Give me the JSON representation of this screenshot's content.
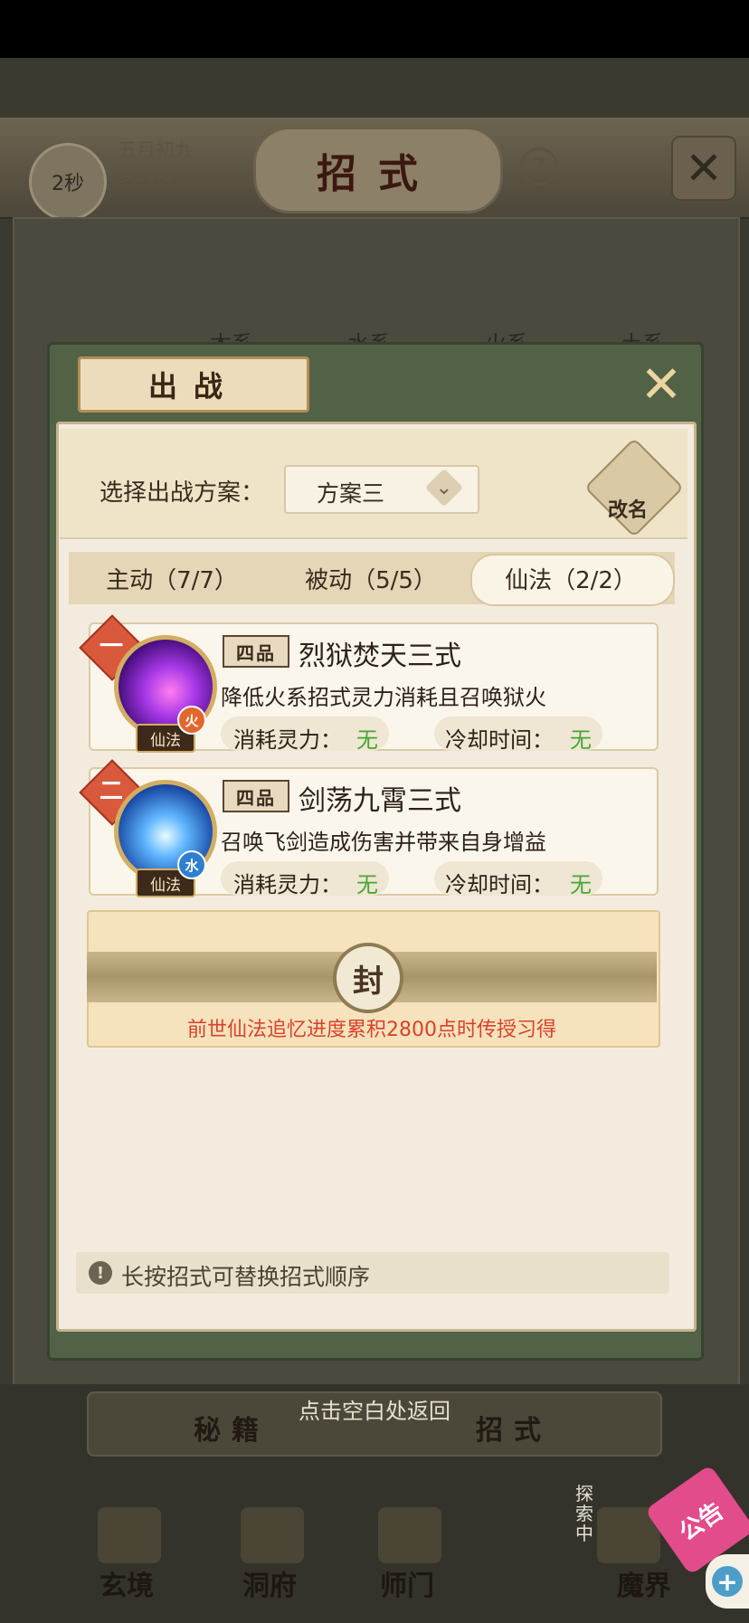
{
  "background": {
    "timer": "2秒",
    "date_line1": "五月初九",
    "date_line2": "亥时夜",
    "title": "招式",
    "help": "?",
    "element_tabs": [
      "木系",
      "水系",
      "火系",
      "土系"
    ]
  },
  "dialog": {
    "title": "出战",
    "scheme_label": "选择出战方案：",
    "scheme_value": "方案三",
    "rename_label": "改名",
    "tabs": [
      {
        "label": "主动（7/7）",
        "active": false
      },
      {
        "label": "被动（5/5）",
        "active": false
      },
      {
        "label": "仙法（2/2）",
        "active": true
      }
    ],
    "skills": [
      {
        "rank": "一",
        "grade": "四品",
        "name": "烈狱焚天三式",
        "description": "降低火系招式灵力消耗且召唤狱火",
        "type_tag": "仙法",
        "element": "火",
        "cost_label": "消耗灵力：",
        "cost_value": "无",
        "cooldown_label": "冷却时间：",
        "cooldown_value": "无"
      },
      {
        "rank": "二",
        "grade": "四品",
        "name": "剑荡九霄三式",
        "description": "召唤飞剑造成伤害并带来自身增益",
        "type_tag": "仙法",
        "element": "水",
        "cost_label": "消耗灵力：",
        "cost_value": "无",
        "cooldown_label": "冷却时间：",
        "cooldown_value": "无"
      }
    ],
    "sealed": {
      "icon_text": "封",
      "text": "前世仙法追忆进度累积2800点时传授习得"
    },
    "hint": "长按招式可替换招式顺序"
  },
  "bottom": {
    "tap_return": "点击空白处返回",
    "sub_tabs": [
      "秘籍",
      "招式"
    ],
    "nav": [
      "玄境",
      "洞府",
      "师门",
      "魔界"
    ],
    "side_label": "探索中",
    "notice": "公告"
  },
  "colors": {
    "accent_green": "#46a636",
    "seal_red": "#d8422c",
    "dialog_frame": "#516247"
  }
}
